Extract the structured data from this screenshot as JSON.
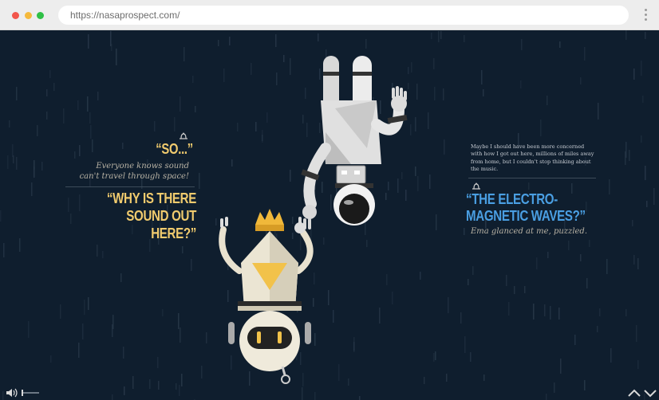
{
  "browser": {
    "url": "https://nasaprospect.com/"
  },
  "story": {
    "left": {
      "exclaim": "“SO...”",
      "narration": "Everyone knows sound can't travel through space!",
      "question": "“WHY IS THERE SOUND OUT HERE?”"
    },
    "right": {
      "narration": "Maybe I should have been more concerned with how I got out here, millions of miles away from home, but I couldn't stop thinking about the music.",
      "question": "“THE ELECTRO-MAGNETIC WAVES?”",
      "reaction": "Ema glanced at me, puzzled."
    }
  },
  "icons": {
    "speaker_left": "speaker-icon",
    "speaker_right": "speaker-icon",
    "volume": "volume-icon",
    "nav": [
      "chevron-up-icon",
      "chevron-down-icon"
    ]
  },
  "colors": {
    "background": "#0f1e2e",
    "yellow_text": "#f1cb6e",
    "blue_text": "#4a9fe3",
    "italic_text": "#b8b2a4"
  }
}
